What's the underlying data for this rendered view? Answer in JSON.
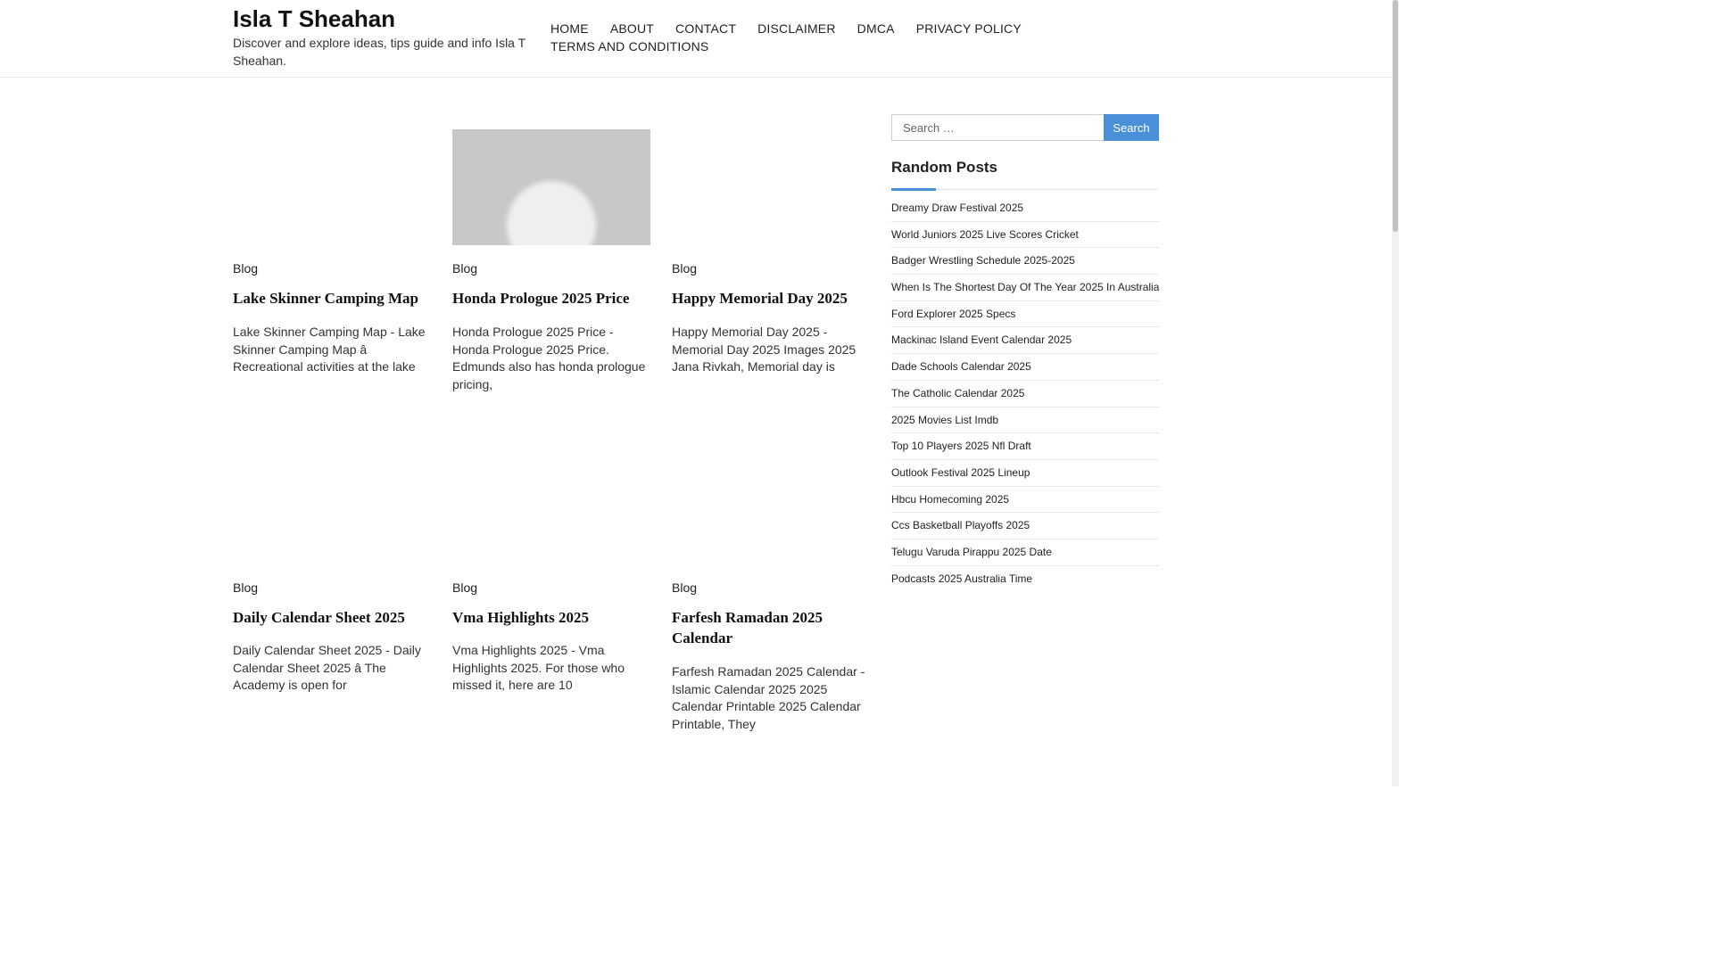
{
  "site": {
    "title": "Isla T Sheahan",
    "description": "Discover and explore ideas, tips guide and info Isla T Sheahan."
  },
  "nav": [
    "HOME",
    "ABOUT",
    "CONTACT",
    "DISCLAIMER",
    "DMCA",
    "PRIVACY POLICY",
    "TERMS AND CONDITIONS"
  ],
  "posts": [
    {
      "category": "Blog",
      "title": "Lake Skinner Camping Map",
      "excerpt": "Lake Skinner Camping Map - Lake Skinner Camping Map â Recreational activities at the lake"
    },
    {
      "category": "Blog",
      "title": "Honda Prologue 2025 Price",
      "excerpt": "Honda Prologue 2025 Price - Honda Prologue 2025 Price. Edmunds also has honda prologue pricing,"
    },
    {
      "category": "Blog",
      "title": "Happy Memorial Day 2025",
      "excerpt": "Happy Memorial Day 2025 - Memorial Day 2025 Images 2025 Jana Rivkah, Memorial day is"
    },
    {
      "category": "Blog",
      "title": "Daily Calendar Sheet 2025",
      "excerpt": "Daily Calendar Sheet 2025 - Daily Calendar Sheet 2025 â The Academy is open for"
    },
    {
      "category": "Blog",
      "title": "Vma Highlights 2025",
      "excerpt": "Vma Highlights 2025 - Vma Highlights 2025. For those who missed it, here are 10"
    },
    {
      "category": "Blog",
      "title": "Farfesh Ramadan 2025 Calendar",
      "excerpt": "Farfesh Ramadan 2025 Calendar - Islamic Calendar 2025 2025 Calendar Printable 2025 Calendar Printable, They"
    }
  ],
  "sidebar": {
    "search": {
      "placeholder": "Search …",
      "button_label": "Search"
    },
    "random_posts_title": "Random Posts",
    "random_posts": [
      "Dreamy Draw Festival 2025",
      "World Juniors 2025 Live Scores Cricket",
      "Badger Wrestling Schedule 2025-2025",
      "When Is The Shortest Day Of The Year 2025 In Australia",
      "Ford Explorer 2025 Specs",
      "Mackinac Island Event Calendar 2025",
      "Dade Schools Calendar 2025",
      "The Catholic Calendar 2025",
      "2025 Movies List Imdb",
      "Top 10 Players 2025 Nfl Draft",
      "Outlook Festival 2025 Lineup",
      "Hbcu Homecoming 2025",
      "Ccs Basketball Playoffs 2025",
      "Telugu Varuda Pirappu 2025 Date",
      "Podcasts 2025 Australia Time"
    ]
  },
  "colors": {
    "accent": "#4a90d9",
    "thumbnail_gray": "#c8c8c8"
  }
}
